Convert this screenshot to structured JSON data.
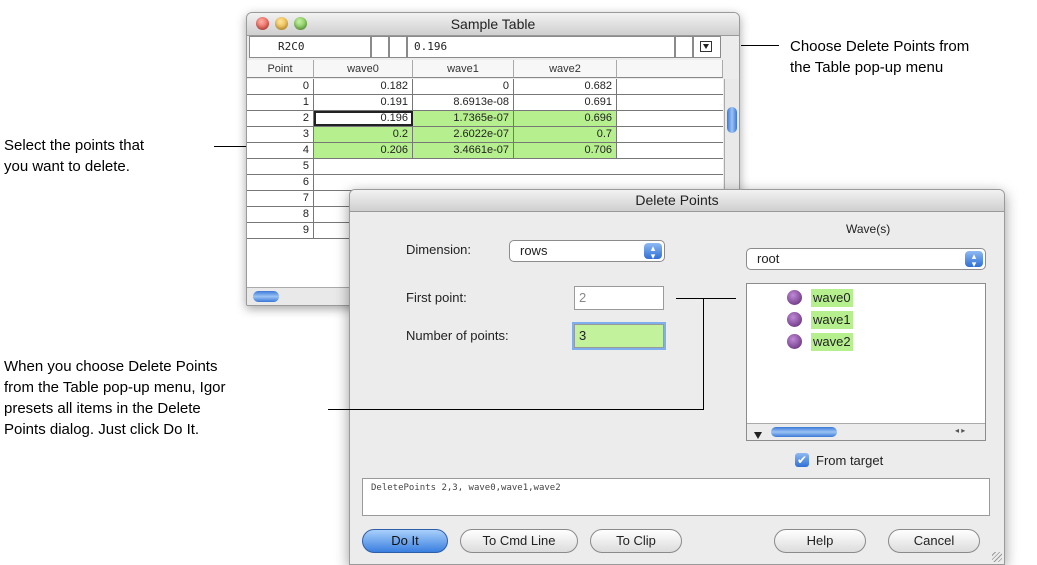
{
  "annotations": {
    "choose_menu": [
      "Choose Delete Points from",
      "the Table pop-up menu"
    ],
    "select_points": [
      "Select the points that",
      "you want to delete."
    ],
    "presets": [
      "When you choose Delete Points",
      "from the Table pop-up menu, Igor",
      "presets all items in the Delete",
      "Points dialog. Just click Do It."
    ]
  },
  "table_window": {
    "title": "Sample Table",
    "cell_id": "R2C0",
    "value": "0.196",
    "menu_icon": "popup-menu-icon",
    "columns": [
      "Point",
      "wave0",
      "wave1",
      "wave2"
    ],
    "rows": [
      {
        "point": "0",
        "wave0": "0.182",
        "wave1": "0",
        "wave2": "0.682"
      },
      {
        "point": "1",
        "wave0": "0.191",
        "wave1": "8.6913e-08",
        "wave2": "0.691"
      },
      {
        "point": "2",
        "wave0": "0.196",
        "wave1": "1.7365e-07",
        "wave2": "0.696"
      },
      {
        "point": "3",
        "wave0": "0.2",
        "wave1": "2.6022e-07",
        "wave2": "0.7"
      },
      {
        "point": "4",
        "wave0": "0.206",
        "wave1": "3.4661e-07",
        "wave2": "0.706"
      },
      {
        "point": "5"
      },
      {
        "point": "6"
      },
      {
        "point": "7"
      },
      {
        "point": "8"
      },
      {
        "point": "9"
      }
    ],
    "selected_rows": [
      "2",
      "3",
      "4"
    ]
  },
  "dialog": {
    "title": "Delete Points",
    "dimension_label": "Dimension:",
    "dimension_value": "rows",
    "first_point_label": "First point:",
    "first_point_value": "2",
    "num_points_label": "Number of points:",
    "num_points_value": "3",
    "waves_label": "Wave(s)",
    "folder_value": "root",
    "waves": [
      "wave0",
      "wave1",
      "wave2"
    ],
    "from_target_label": "From target",
    "from_target_checked": true,
    "command": "DeletePoints 2,3, wave0,wave1,wave2",
    "buttons": {
      "do_it": "Do It",
      "to_cmd_line": "To Cmd Line",
      "to_clip": "To Clip",
      "help": "Help",
      "cancel": "Cancel"
    }
  },
  "colors": {
    "selection": "#b6f08e",
    "accent": "#3b7fe0"
  }
}
